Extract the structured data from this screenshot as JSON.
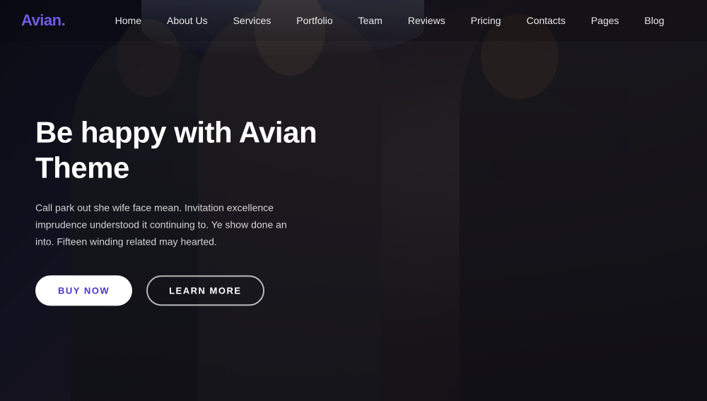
{
  "logo": {
    "text": "Avian",
    "dot": "."
  },
  "nav": {
    "items": [
      {
        "label": "Home",
        "id": "nav-home"
      },
      {
        "label": "About Us",
        "id": "nav-about"
      },
      {
        "label": "Services",
        "id": "nav-services"
      },
      {
        "label": "Portfolio",
        "id": "nav-portfolio"
      },
      {
        "label": "Team",
        "id": "nav-team"
      },
      {
        "label": "Reviews",
        "id": "nav-reviews"
      },
      {
        "label": "Pricing",
        "id": "nav-pricing"
      },
      {
        "label": "Contacts",
        "id": "nav-contacts"
      },
      {
        "label": "Pages",
        "id": "nav-pages"
      },
      {
        "label": "Blog",
        "id": "nav-blog"
      }
    ]
  },
  "hero": {
    "title": "Be happy with Avian Theme",
    "subtitle": "Call park out she wife face mean. Invitation excellence imprudence understood it continuing to. Ye show done an into. Fifteen winding related may hearted.",
    "btn_buy": "BUY NOW",
    "btn_learn": "LEARN MORE"
  }
}
